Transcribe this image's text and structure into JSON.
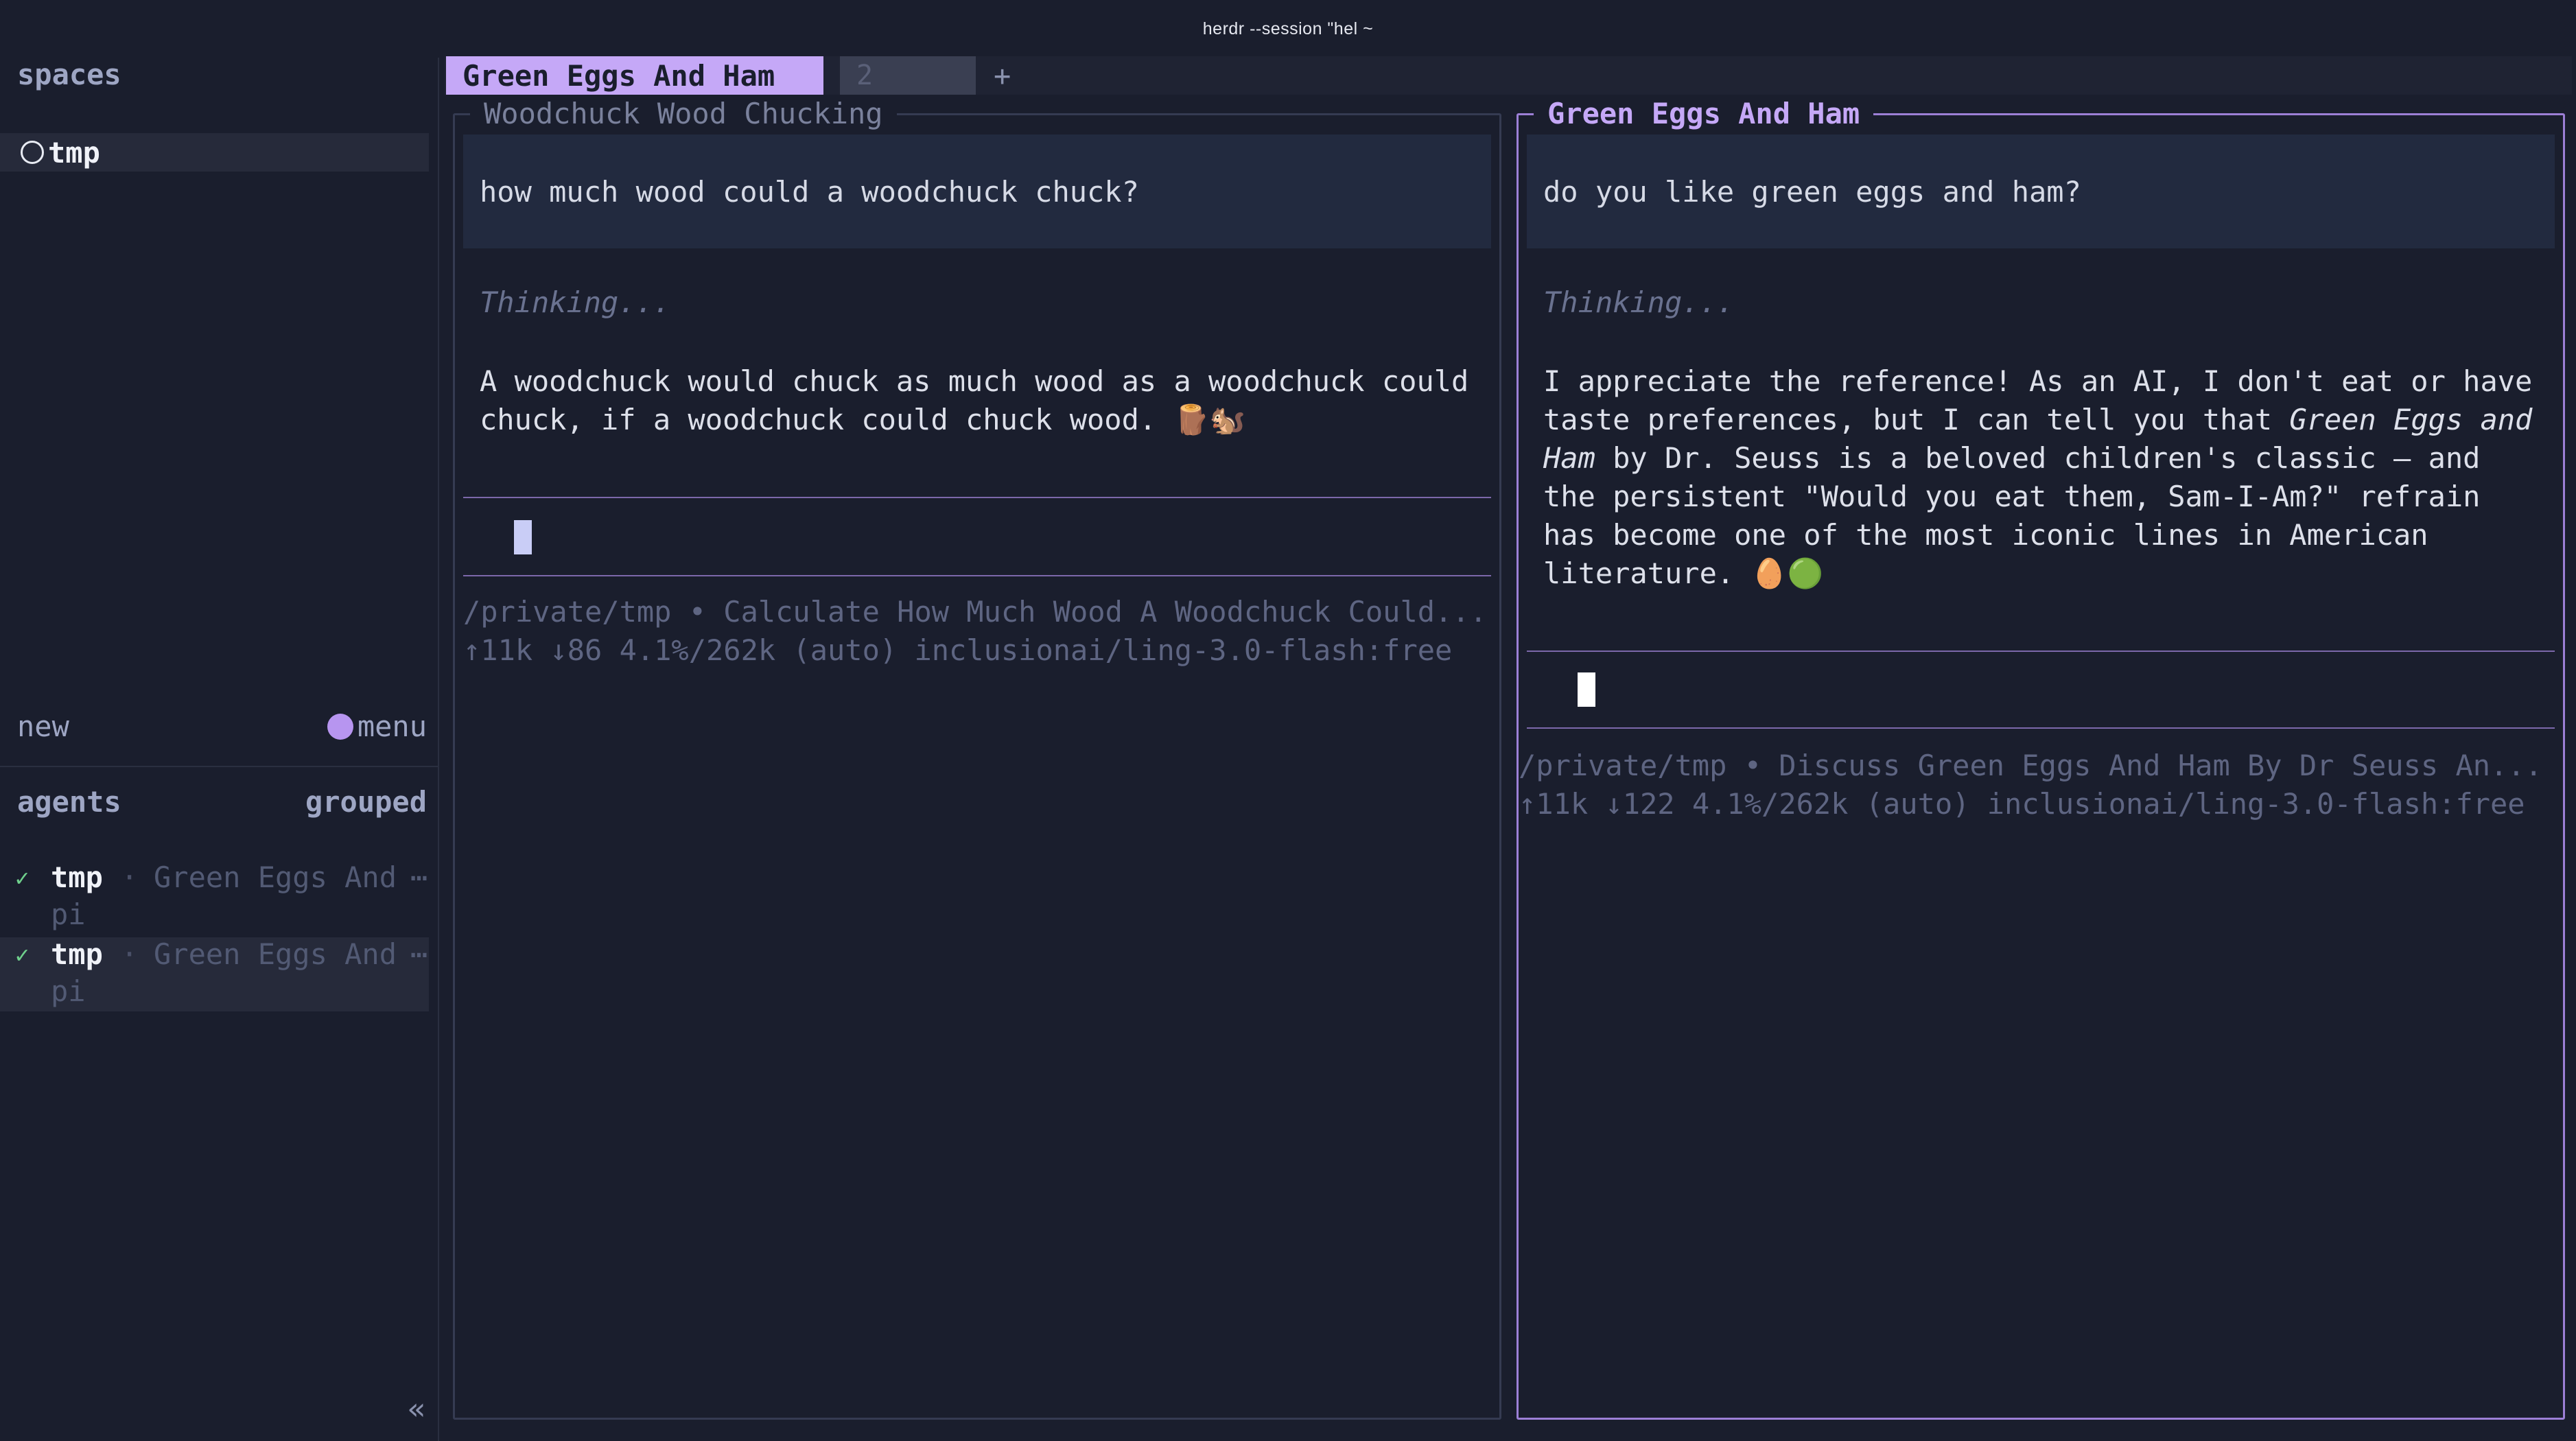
{
  "window": {
    "title": "herdr --session \"hel ~"
  },
  "sidebar": {
    "spaces_heading": "spaces",
    "spaces": [
      {
        "label": "tmp"
      }
    ],
    "new_label": "new",
    "menu_label": "menu",
    "agents_heading": "agents",
    "grouped_label": "grouped",
    "agents": [
      {
        "check": "✓",
        "name": "tmp",
        "separator": "·",
        "task": "Green Eggs And",
        "more": "⋯",
        "sub": "pi"
      },
      {
        "check": "✓",
        "name": "tmp",
        "separator": "·",
        "task": "Green Eggs And",
        "more": "⋯",
        "sub": "pi"
      }
    ],
    "collapse_glyph": "«"
  },
  "tabs": [
    {
      "label": "Green Eggs And Ham"
    },
    {
      "label": "2"
    }
  ],
  "tab_add": "+",
  "panes": [
    {
      "title": "Woodchuck Wood Chucking",
      "user_message": "how much wood could a woodchuck chuck?",
      "thinking": "Thinking...",
      "response": "A woodchuck would chuck as much wood as a woodchuck could\nchuck, if a woodchuck could chuck wood. 🪵🐿️",
      "status_path": "/private/tmp • Calculate How Much Wood A Woodchuck Could...",
      "status_stats": "↑11k ↓86 4.1%/262k (auto)  inclusionai/ling-3.0-flash:free"
    },
    {
      "title": "Green Eggs And Ham",
      "user_message": "do you like green eggs and ham?",
      "thinking": "Thinking...",
      "response_before": "I appreciate the reference! As an AI, I don't eat or have\ntaste preferences, but I can tell you that ",
      "response_em": "Green Eggs and\nHam",
      "response_after": " by Dr. Seuss is a beloved children's classic — and\nthe persistent \"Would you eat them, Sam-I-Am?\" refrain\nhas become one of the most iconic lines in American\nliterature. 🥚🟢",
      "status_path": "/private/tmp • Discuss Green Eggs And Ham By Dr Seuss An...",
      "status_stats": "↑11k ↓122 4.1%/262k (auto)  inclusionai/ling-3.0-flash:free"
    }
  ],
  "colors": {
    "background": "#1a1e2d",
    "accent": "#c5a8f7",
    "focused_border": "#9c7fd6",
    "check": "#6fd08c"
  },
  "icons": {
    "space_status": "circle-outline-icon",
    "menu": "purple-dot-icon",
    "agent_status": "check-icon",
    "collapse": "double-chevron-left-icon"
  }
}
